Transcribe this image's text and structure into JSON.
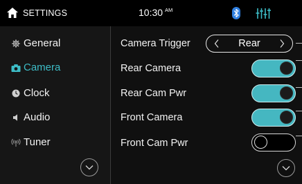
{
  "header": {
    "title": "SETTINGS",
    "time": "10:30",
    "ampm": "AM",
    "icons": {
      "home": "home-icon",
      "bluetooth": "bluetooth-icon",
      "equalizer": "equalizer-icon"
    }
  },
  "sidebar": {
    "items": [
      {
        "label": "General",
        "icon": "gear-icon",
        "active": false
      },
      {
        "label": "Camera",
        "icon": "camera-icon",
        "active": true
      },
      {
        "label": "Clock",
        "icon": "clock-icon",
        "active": false
      },
      {
        "label": "Audio",
        "icon": "speaker-icon",
        "active": false
      },
      {
        "label": "Tuner",
        "icon": "antenna-icon",
        "active": false
      }
    ]
  },
  "settings": {
    "camera_trigger": {
      "label": "Camera Trigger",
      "value": "Rear"
    },
    "toggles": [
      {
        "label": "Rear Camera",
        "on": true
      },
      {
        "label": "Rear Cam Pwr",
        "on": true
      },
      {
        "label": "Front Camera",
        "on": true
      },
      {
        "label": "Front Cam Pwr",
        "on": false
      }
    ]
  },
  "colors": {
    "accent": "#3dbcc6",
    "toggle_on": "#45b7c1",
    "background": "#101010",
    "sidebar": "#161616",
    "topbar": "#000000"
  }
}
